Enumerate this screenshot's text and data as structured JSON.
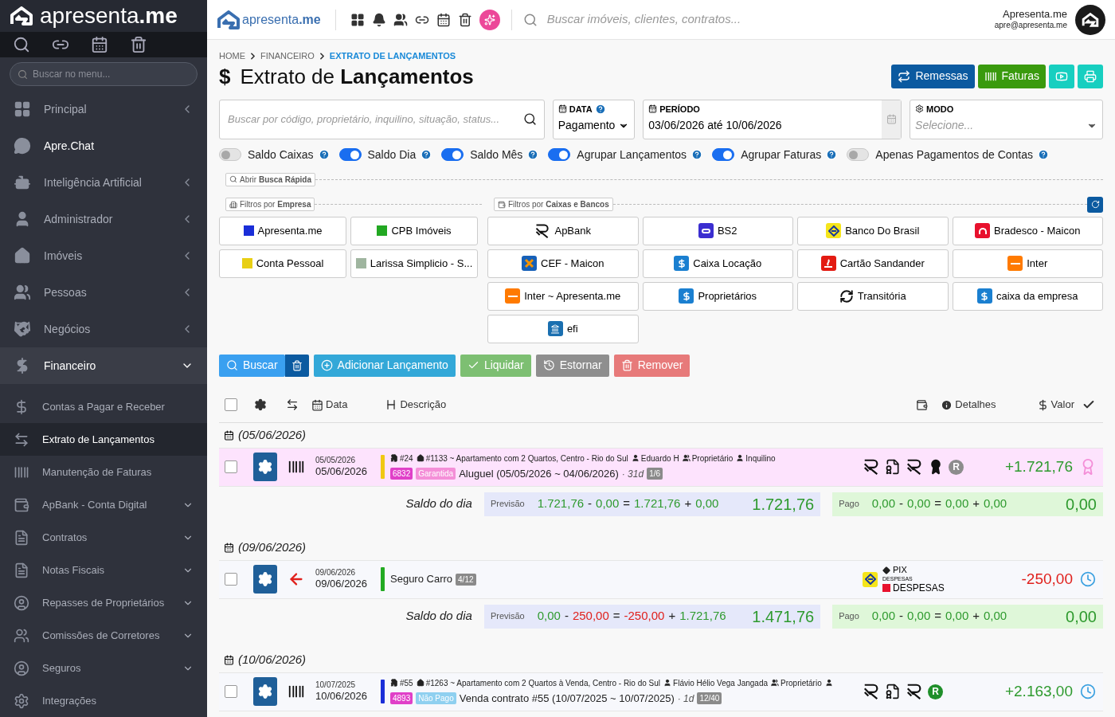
{
  "sidebar": {
    "brand": "apresenta**.me**",
    "search_placeholder": "Buscar no menu...",
    "items": [
      {
        "label": "Principal",
        "emphasized": false,
        "expanded": false,
        "has_children": true
      },
      {
        "label": "Apre.Chat",
        "emphasized": true,
        "expanded": false,
        "has_children": false
      },
      {
        "label": "Inteligência Artificial",
        "emphasized": false,
        "expanded": false,
        "has_children": true
      },
      {
        "label": "Administrador",
        "emphasized": false,
        "expanded": false,
        "has_children": true
      },
      {
        "label": "Imóveis",
        "emphasized": false,
        "expanded": false,
        "has_children": true
      },
      {
        "label": "Pessoas",
        "emphasized": false,
        "expanded": false,
        "has_children": true
      },
      {
        "label": "Negócios",
        "emphasized": false,
        "expanded": false,
        "has_children": true
      },
      {
        "label": "Financeiro",
        "emphasized": true,
        "expanded": true,
        "has_children": true,
        "children": [
          {
            "label": "Contas a Pagar e Receber",
            "selected": false,
            "has_children": false
          },
          {
            "label": "Extrato de Lançamentos",
            "selected": true,
            "has_children": false
          },
          {
            "label": "Manutenção de Faturas",
            "selected": false,
            "has_children": false
          },
          {
            "label": "ApBank - Conta Digital",
            "selected": false,
            "has_children": true
          },
          {
            "label": "Contratos",
            "selected": false,
            "has_children": true
          },
          {
            "label": "Notas Fiscais",
            "selected": false,
            "has_children": true
          },
          {
            "label": "Repasses de Proprietários",
            "selected": false,
            "has_children": true
          },
          {
            "label": "Comissões de Corretores",
            "selected": false,
            "has_children": true
          },
          {
            "label": "Seguros",
            "selected": false,
            "has_children": true
          },
          {
            "label": "Integrações",
            "selected": false,
            "has_children": false
          }
        ]
      }
    ]
  },
  "header": {
    "brand": "apresenta**.me**",
    "search_placeholder": "Buscar imóveis, clientes, contratos...",
    "user_name": "Apresenta.me",
    "user_email": "apre@apresenta.me"
  },
  "breadcrumb": [
    "HOME",
    "FINANCEIRO",
    "EXTRATO DE LANÇAMENTOS"
  ],
  "title_symbol": "$",
  "title": "Extrato de **Lançamentos**",
  "top_buttons": [
    {
      "label": "Remessas"
    },
    {
      "label": "Faturas"
    }
  ],
  "filters": {
    "search_placeholder": "Buscar por código, proprietário, inquilino, situação, status...",
    "data": {
      "label": "DATA",
      "value": "Pagamento"
    },
    "periodo": {
      "label": "PERÍODO",
      "value": "03/06/2026 até 10/06/2026"
    },
    "modo": {
      "label": "MODO",
      "placeholder": "Selecione..."
    }
  },
  "toggles": [
    {
      "label": "Saldo Caixas",
      "on": false
    },
    {
      "label": "Saldo Dia",
      "on": true
    },
    {
      "label": "Saldo Mês",
      "on": true
    },
    {
      "label": "Agrupar Lançamentos",
      "on": true
    },
    {
      "label": "Agrupar Faturas",
      "on": true
    },
    {
      "label": "Apenas Pagamentos de Contas",
      "on": false
    }
  ],
  "quick_search": "Abrir **Busca Rápida**",
  "company_section": "Filtros por **Empresa**",
  "bank_section": "Filtros por **Caixas e Bancos**",
  "companies": [
    {
      "label": "Apresenta.me",
      "color": "#1a2ed8"
    },
    {
      "label": "CPB Imóveis",
      "color": "#22a822"
    },
    {
      "label": "Conta Pessoal",
      "color": "#e8cf14"
    },
    {
      "label": "Larissa Simplicio - S...",
      "color": "#9fb59f"
    }
  ],
  "banks": [
    {
      "label": "ApBank",
      "kind": "apbank"
    },
    {
      "label": "BS2",
      "kind": "bs2"
    },
    {
      "label": "Banco Do Brasil",
      "kind": "bb"
    },
    {
      "label": "Bradesco - Maicon",
      "kind": "bradesco"
    },
    {
      "label": "CEF - Maicon",
      "kind": "cef"
    },
    {
      "label": "Caixa Locação",
      "kind": "cash"
    },
    {
      "label": "Cartão Sandander",
      "kind": "santander"
    },
    {
      "label": "Inter",
      "kind": "inter"
    },
    {
      "label": "Inter ~ Apresenta.me",
      "kind": "inter"
    },
    {
      "label": "Proprietários",
      "kind": "cash"
    },
    {
      "label": "Transitória",
      "kind": "transit"
    },
    {
      "label": "caixa da empresa",
      "kind": "cash"
    },
    {
      "label": "efi",
      "kind": "efi"
    }
  ],
  "actions": [
    {
      "label": "Buscar",
      "kind": "search",
      "disabled": false
    },
    {
      "label": "Adicionar Lançamento",
      "kind": "add",
      "disabled": false
    },
    {
      "label": "Liquidar",
      "kind": "settle",
      "disabled": true
    },
    {
      "label": "Estornar",
      "kind": "reverse",
      "disabled": true
    },
    {
      "label": "Remover",
      "kind": "remove",
      "disabled": true
    }
  ],
  "select_all": {
    "checked": false
  },
  "columns": {
    "data": "Data",
    "descricao": "Descrição",
    "detalhes": "Detalhes",
    "valor": "Valor"
  },
  "groups": [
    {
      "date": "(05/06/2026)",
      "entries": [
        {
          "checked": false,
          "highlighted": true,
          "lead": {
            "kind": "barcode"
          },
          "date_small": "05/05/2026",
          "date": "05/06/2026",
          "color": "#f0c814",
          "meta": [
            {
              "kind": "contract",
              "text": "#24"
            },
            {
              "kind": "property",
              "text": "#1133 ~ Apartamento com 2 Quartos, Centro - Rio do Sul"
            },
            {
              "kind": "person",
              "text": "Eduardo H"
            },
            {
              "kind": "role",
              "text": "Proprietário"
            },
            {
              "kind": "person",
              "text": "Inquilino"
            }
          ],
          "code": "6832",
          "status": {
            "text": "Garantida",
            "color": "#f48fd8"
          },
          "description": "Aluguel (05/05/2026 ~ 04/06/2026)",
          "days": "· 31d",
          "installment": "1/6",
          "right_icons": [
            {
              "kind": "apbank"
            },
            {
              "kind": "certificate"
            },
            {
              "kind": "apbank"
            },
            {
              "kind": "award"
            }
          ],
          "letter": {
            "text": "R",
            "color": "#8c8c8c"
          },
          "amount": "+1.721,76",
          "negative": false,
          "end": {
            "kind": "guarantee"
          }
        }
      ],
      "saldo": {
        "label": "Saldo do dia",
        "previsao": {
          "label": "Previsão",
          "terms": [
            {
              "text": "1.721,76",
              "kind": "positive"
            },
            {
              "text": "-",
              "kind": "neutral"
            },
            {
              "text": "0,00",
              "kind": "positive"
            },
            {
              "text": "=",
              "kind": "neutral"
            },
            {
              "text": "1.721,76",
              "kind": "positive"
            },
            {
              "text": "+",
              "kind": "neutral"
            },
            {
              "text": "0,00",
              "kind": "positive"
            }
          ],
          "total": "1.721,76"
        },
        "pago": {
          "label": "Pago",
          "terms": [
            {
              "text": "0,00",
              "kind": "positive"
            },
            {
              "text": "-",
              "kind": "neutral"
            },
            {
              "text": "0,00",
              "kind": "positive"
            },
            {
              "text": "=",
              "kind": "neutral"
            },
            {
              "text": "0,00",
              "kind": "positive"
            },
            {
              "text": "+",
              "kind": "neutral"
            },
            {
              "text": "0,00",
              "kind": "positive"
            }
          ],
          "total": "0,00"
        }
      }
    },
    {
      "date": "(09/06/2026)",
      "entries": [
        {
          "checked": false,
          "highlighted": false,
          "lead": {
            "kind": "arrow"
          },
          "date_small": "09/06/2026",
          "date": "09/06/2026",
          "color": "#22aa22",
          "description": "Seguro Carro",
          "installment": "4/12",
          "details": {
            "method": "PIX",
            "category_small": "DESPESAS",
            "category": "DESPESAS"
          },
          "amount": "-250,00",
          "negative": true,
          "end": {
            "kind": "pending"
          }
        }
      ],
      "saldo": {
        "label": "Saldo do dia",
        "previsao": {
          "label": "Previsão",
          "terms": [
            {
              "text": "0,00",
              "kind": "positive"
            },
            {
              "text": "-",
              "kind": "neutral"
            },
            {
              "text": "250,00",
              "kind": "negative"
            },
            {
              "text": "=",
              "kind": "neutral"
            },
            {
              "text": "-250,00",
              "kind": "negative"
            },
            {
              "text": "+",
              "kind": "neutral"
            },
            {
              "text": "1.721,76",
              "kind": "positive"
            }
          ],
          "total": "1.471,76"
        },
        "pago": {
          "label": "Pago",
          "terms": [
            {
              "text": "0,00",
              "kind": "positive"
            },
            {
              "text": "-",
              "kind": "neutral"
            },
            {
              "text": "0,00",
              "kind": "positive"
            },
            {
              "text": "=",
              "kind": "neutral"
            },
            {
              "text": "0,00",
              "kind": "positive"
            },
            {
              "text": "+",
              "kind": "neutral"
            },
            {
              "text": "0,00",
              "kind": "positive"
            }
          ],
          "total": "0,00"
        }
      }
    },
    {
      "date": "(10/06/2026)",
      "entries": [
        {
          "checked": false,
          "highlighted": false,
          "lead": {
            "kind": "barcode"
          },
          "date_small": "10/07/2025",
          "date": "10/06/2026",
          "color": "#1a2ed8",
          "meta": [
            {
              "kind": "contract",
              "text": "#55"
            },
            {
              "kind": "property",
              "text": "#1263 ~ Apartamento com 2 Quartos à Venda, Centro - Rio do Sul"
            },
            {
              "kind": "person",
              "text": "Flávio Hélio Vega Jangada"
            },
            {
              "kind": "role",
              "text": "Proprietário"
            },
            {
              "kind": "person"
            }
          ],
          "code": "4893",
          "status": {
            "text": "Não Pago",
            "color": "#8fd0f0"
          },
          "description": "Venda contrato #55 (10/07/2025 ~ 10/07/2025)",
          "days": "· 1d",
          "installment": "12/40",
          "right_icons": [
            {
              "kind": "apbank"
            },
            {
              "kind": "certificate"
            },
            {
              "kind": "apbank"
            }
          ],
          "letter": {
            "text": "R",
            "color": "#1f8f2a"
          },
          "amount": "+2.163,00",
          "negative": false,
          "end": {
            "kind": "pending"
          }
        }
      ]
    }
  ]
}
